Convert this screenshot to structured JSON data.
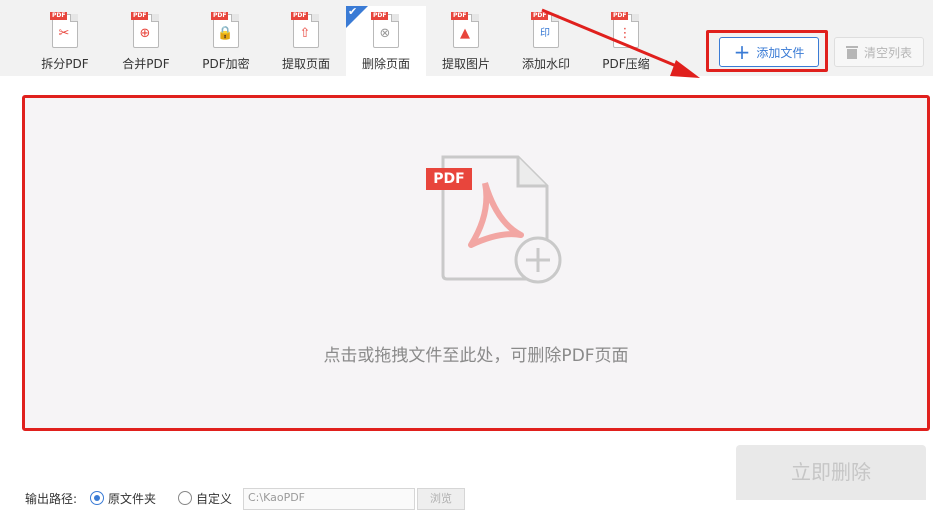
{
  "toolbar": {
    "tools": [
      {
        "label": "拆分PDF",
        "icon": "split-pdf-icon",
        "tag": "PDF",
        "glyph": "✂"
      },
      {
        "label": "合并PDF",
        "icon": "merge-pdf-icon",
        "tag": "PDF",
        "glyph": "⊕"
      },
      {
        "label": "PDF加密",
        "icon": "encrypt-pdf-icon",
        "tag": "PDF",
        "glyph": "🔒"
      },
      {
        "label": "提取页面",
        "icon": "extract-pages-icon",
        "tag": "PDF",
        "glyph": "⇧"
      },
      {
        "label": "删除页面",
        "icon": "delete-pages-icon",
        "tag": "PDF",
        "glyph": "⊗"
      },
      {
        "label": "提取图片",
        "icon": "extract-images-icon",
        "tag": "PDF",
        "glyph": "▲"
      },
      {
        "label": "添加水印",
        "icon": "add-watermark-icon",
        "tag": "PDF",
        "glyph": "印"
      },
      {
        "label": "PDF压缩",
        "icon": "compress-pdf-icon",
        "tag": "PDF",
        "glyph": "⋮"
      }
    ],
    "active_index": 4,
    "add_file_label": "添加文件",
    "clear_list_label": "清空列表"
  },
  "dropzone": {
    "tag": "PDF",
    "hint": "点击或拖拽文件至此处，可删除PDF页面"
  },
  "output": {
    "label": "输出路径:",
    "option_original": "原文件夹",
    "option_custom": "自定义",
    "path_value": "C:\\KaoPDF",
    "browse_label": "浏览"
  },
  "run_button_label": "立即删除",
  "colors": {
    "accent": "#3a7bd5",
    "highlight_red": "#e0201d",
    "pdf_red": "#e8453c"
  }
}
